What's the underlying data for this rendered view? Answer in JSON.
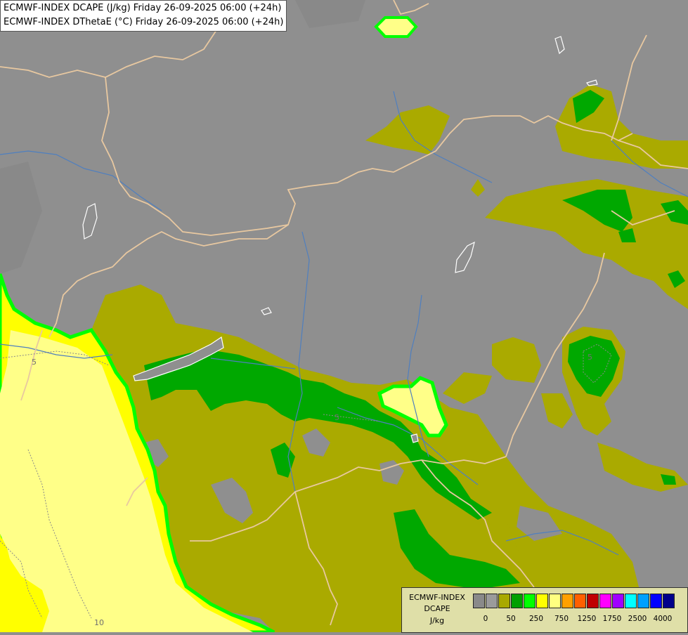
{
  "header": {
    "line1": "ECMWF-INDEX DCAPE (J/kg) Friday 26-09-2025 06:00 (+24h)",
    "line2": "ECMWF-INDEX DThetaE (°C) Friday 26-09-2025 06:00 (+24h)"
  },
  "contour_labels": [
    "5",
    "5",
    "5",
    "10"
  ],
  "legend": {
    "title1": "ECMWF-INDEX",
    "title2": "DCAPE",
    "unit": "J/kg",
    "colors": [
      "#8a8a8a",
      "#9b9b9b",
      "#a9a900",
      "#00a000",
      "#00ff00",
      "#ffff00",
      "#ffff80",
      "#ffa000",
      "#ff6000",
      "#c00000",
      "#ff00ff",
      "#a000ff",
      "#00ffff",
      "#00a0ff",
      "#0000ff",
      "#00008b"
    ],
    "ticks": [
      "0",
      "50",
      "250",
      "750",
      "1250",
      "1750",
      "2500",
      "4000"
    ]
  },
  "colors": {
    "background_gray": "#8f8f8f",
    "olive": "#aaaa00",
    "green": "#00a800",
    "bright_green": "#00ff00",
    "yellow": "#ffff00",
    "light_yellow": "#ffff88",
    "border_tan": "#e8c8a0",
    "river_blue": "#4f7fbf"
  }
}
